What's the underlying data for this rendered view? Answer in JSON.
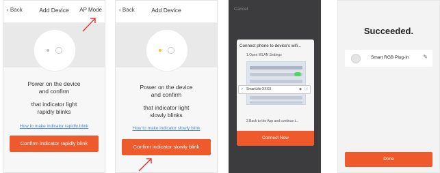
{
  "screen1": {
    "back_label": "Back",
    "title": "Add Device",
    "ap_mode_label": "AP Mode",
    "instruction_lines": [
      "Power on the device",
      "and confirm",
      "that indicator light",
      "rapidly blinks"
    ],
    "help_link": "How to make indicator rapidly blink",
    "confirm_button": "Confirm indicator rapidly blink"
  },
  "screen2": {
    "back_label": "Back",
    "title": "Add Device",
    "instruction_lines": [
      "Power on the device",
      "and confirm",
      "that indicator light",
      "slowly blinks"
    ],
    "help_link": "How to make indicator slowly blink",
    "confirm_button": "Confirm indicator slowly blink"
  },
  "screen3": {
    "cancel_label": "Cancel",
    "dialog_title": "Connect phone to device's wifi...",
    "step1": "1.Open WLAN Settings",
    "network_name": "SmartLife-XXXX",
    "step2": "2.Back to the App and continue t...",
    "connect_button": "Connect Now"
  },
  "screen4": {
    "title": "Succeeded.",
    "device_name": "Smart RGB Plug-In",
    "done_button": "Done"
  },
  "colors": {
    "accent": "#ee5a2b",
    "link": "#4a86d8",
    "dark_bg": "#3c3b3e"
  },
  "icons": [
    "chevron-left-icon",
    "power-icon",
    "red-arrow-icon",
    "wifi-icon",
    "checkmark-icon",
    "lock-icon",
    "info-icon",
    "device-icon",
    "pencil-icon"
  ]
}
